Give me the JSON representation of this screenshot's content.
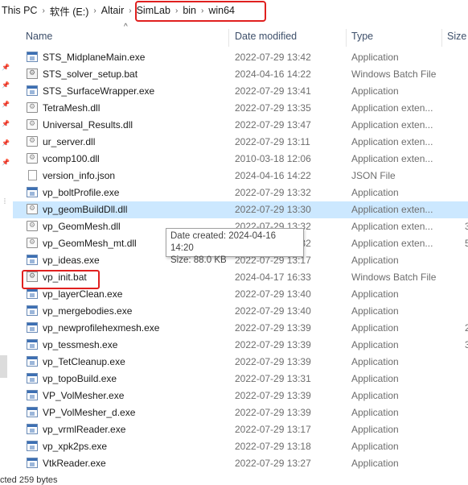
{
  "breadcrumb": [
    "This PC",
    "软件 (E:)",
    "Altair",
    "SimLab",
    "bin",
    "win64"
  ],
  "columns": {
    "name": "Name",
    "date": "Date modified",
    "type": "Type",
    "size": "Size"
  },
  "files": [
    {
      "name": "STS_MidplaneMain.exe",
      "date": "2022-07-29 13:42",
      "type": "Application",
      "size": "",
      "icon": "exe"
    },
    {
      "name": "STS_solver_setup.bat",
      "date": "2024-04-16 14:22",
      "type": "Windows Batch File",
      "size": "",
      "icon": "bat"
    },
    {
      "name": "STS_SurfaceWrapper.exe",
      "date": "2022-07-29 13:41",
      "type": "Application",
      "size": "",
      "icon": "exe"
    },
    {
      "name": "TetraMesh.dll",
      "date": "2022-07-29 13:35",
      "type": "Application exten...",
      "size": "",
      "icon": "dll"
    },
    {
      "name": "Universal_Results.dll",
      "date": "2022-07-29 13:47",
      "type": "Application exten...",
      "size": "",
      "icon": "dll"
    },
    {
      "name": "ur_server.dll",
      "date": "2022-07-29 13:11",
      "type": "Application exten...",
      "size": "",
      "icon": "dll"
    },
    {
      "name": "vcomp100.dll",
      "date": "2010-03-18 12:06",
      "type": "Application exten...",
      "size": "",
      "icon": "dll"
    },
    {
      "name": "version_info.json",
      "date": "2024-04-16 14:22",
      "type": "JSON File",
      "size": "",
      "icon": "json"
    },
    {
      "name": "vp_boltProfile.exe",
      "date": "2022-07-29 13:32",
      "type": "Application",
      "size": "",
      "icon": "exe"
    },
    {
      "name": "vp_geomBuildDll.dll",
      "date": "2022-07-29 13:30",
      "type": "Application exten...",
      "size": "",
      "icon": "dll"
    },
    {
      "name": "vp_GeomMesh.dll",
      "date": "2022-07-29 13:32",
      "type": "Application exten...",
      "size": "3",
      "icon": "dll"
    },
    {
      "name": "vp_GeomMesh_mt.dll",
      "date": "2022-07-29 13:32",
      "type": "Application exten...",
      "size": "5",
      "icon": "dll"
    },
    {
      "name": "vp_ideas.exe",
      "date": "2022-07-29 13:17",
      "type": "Application",
      "size": "",
      "icon": "exe"
    },
    {
      "name": "vp_init.bat",
      "date": "2024-04-17 16:33",
      "type": "Windows Batch File",
      "size": "",
      "icon": "bat"
    },
    {
      "name": "vp_layerClean.exe",
      "date": "2022-07-29 13:40",
      "type": "Application",
      "size": "",
      "icon": "exe"
    },
    {
      "name": "vp_mergebodies.exe",
      "date": "2022-07-29 13:40",
      "type": "Application",
      "size": "",
      "icon": "exe"
    },
    {
      "name": "vp_newprofilehexmesh.exe",
      "date": "2022-07-29 13:39",
      "type": "Application",
      "size": "2",
      "icon": "exe"
    },
    {
      "name": "vp_tessmesh.exe",
      "date": "2022-07-29 13:39",
      "type": "Application",
      "size": "3",
      "icon": "exe"
    },
    {
      "name": "vp_TetCleanup.exe",
      "date": "2022-07-29 13:39",
      "type": "Application",
      "size": "",
      "icon": "exe"
    },
    {
      "name": "vp_topoBuild.exe",
      "date": "2022-07-29 13:31",
      "type": "Application",
      "size": "",
      "icon": "exe"
    },
    {
      "name": "VP_VolMesher.exe",
      "date": "2022-07-29 13:39",
      "type": "Application",
      "size": "",
      "icon": "exe"
    },
    {
      "name": "VP_VolMesher_d.exe",
      "date": "2022-07-29 13:39",
      "type": "Application",
      "size": "",
      "icon": "exe"
    },
    {
      "name": "vp_vrmlReader.exe",
      "date": "2022-07-29 13:17",
      "type": "Application",
      "size": "",
      "icon": "exe"
    },
    {
      "name": "vp_xpk2ps.exe",
      "date": "2022-07-29 13:18",
      "type": "Application",
      "size": "",
      "icon": "exe"
    },
    {
      "name": "VtkReader.exe",
      "date": "2022-07-29 13:27",
      "type": "Application",
      "size": "",
      "icon": "exe"
    }
  ],
  "tooltip": {
    "line1": "Date created: 2024-04-16 14:20",
    "line2": "Size: 88.0 KB"
  },
  "status": "cted 259 bytes",
  "colors": {
    "highlight_box": "#e0201f",
    "hover_row": "#cce8ff"
  }
}
